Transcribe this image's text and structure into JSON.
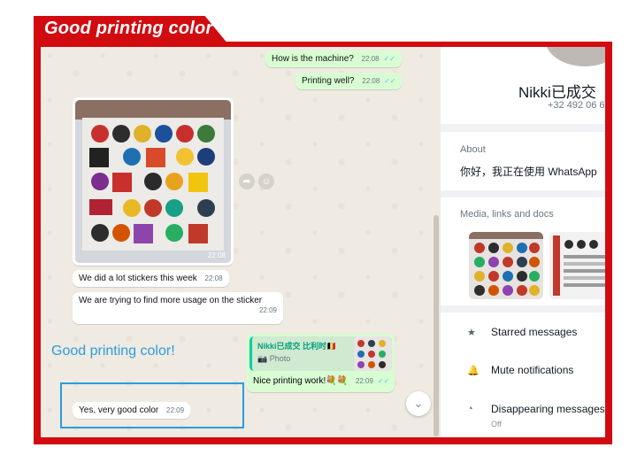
{
  "banner": {
    "title": "Good printing color"
  },
  "chat": {
    "messages": [
      {
        "dir": "out",
        "text": "How is the machine?",
        "time": "22:08",
        "ticks": "✓✓"
      },
      {
        "dir": "out",
        "text": "Printing well?",
        "time": "22:08",
        "ticks": "✓✓"
      },
      {
        "dir": "in",
        "type": "photo",
        "time": "22:08"
      },
      {
        "dir": "in",
        "text": "We did a lot stickers this week",
        "time": "22:08"
      },
      {
        "dir": "in",
        "text": "We are trying to find more usage on the sticker",
        "time": "22:09"
      },
      {
        "dir": "out",
        "type": "reply",
        "quote_name": "Nikki已成交 比利时🇧🇪",
        "quote_type": "Photo",
        "text": "Nice printing work!💐💐",
        "time": "22:09",
        "ticks": "✓✓"
      },
      {
        "dir": "in",
        "text": "Yes, very good color",
        "time": "22:09"
      }
    ],
    "overlay_label": "Good printing color!",
    "camera_icon": "camera-icon",
    "forward_icon": "forward-icon",
    "emoji_icon": "emoji-icon",
    "scroll_down_icon": "chevron-down-icon"
  },
  "contact": {
    "name": "Nikki已成交",
    "phone": "+32 492 06 6",
    "about_label": "About",
    "about_text": "你好，我正在使用 WhatsApp",
    "media_label": "Media, links and docs",
    "menu": [
      {
        "icon": "star-icon",
        "glyph": "★",
        "label": "Starred messages",
        "sub": ""
      },
      {
        "icon": "bell-icon",
        "glyph": "🔔",
        "label": "Mute notifications",
        "sub": ""
      },
      {
        "icon": "timer-icon",
        "glyph": "◔",
        "label": "Disappearing messages",
        "sub": "Off"
      }
    ]
  },
  "colors": {
    "frame": "#d10b10",
    "outgoing": "#d9fdd3",
    "incoming": "#ffffff",
    "label": "#2c9cdc"
  }
}
